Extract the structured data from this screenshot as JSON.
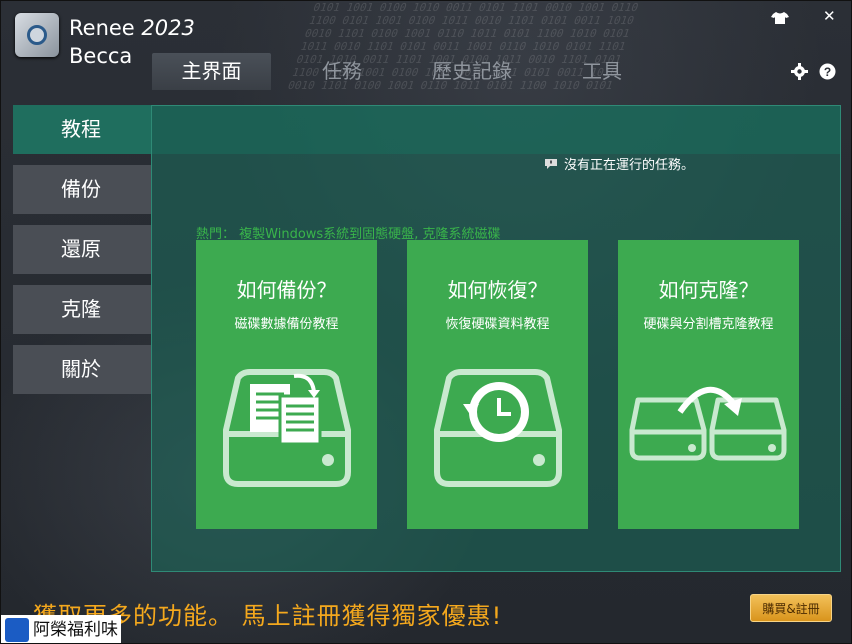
{
  "header": {
    "app_name": "Renee",
    "version": "2023",
    "product": "Becca",
    "tabs": [
      {
        "label": "主界面",
        "active": true
      },
      {
        "label": "任務",
        "active": false
      },
      {
        "label": "歷史記錄",
        "active": false
      },
      {
        "label": "工具",
        "active": false
      }
    ],
    "window_controls": {
      "skin": "shirt-icon",
      "close": "✕"
    }
  },
  "sidebar": {
    "items": [
      {
        "label": "教程",
        "active": true
      },
      {
        "label": "備份",
        "active": false
      },
      {
        "label": "還原",
        "active": false
      },
      {
        "label": "克隆",
        "active": false
      },
      {
        "label": "關於",
        "active": false
      }
    ]
  },
  "main": {
    "status": "沒有正在運行的任務。",
    "hot_prefix": "熱門：",
    "hot_link_1": "複製Windows系統到固態硬盤",
    "hot_sep": ",",
    "hot_link_2": "克隆系統磁碟",
    "cards": [
      {
        "title": "如何備份？",
        "subtitle": "磁碟數據備份教程",
        "icon": "backup-drive-icon"
      },
      {
        "title": "如何恢復？",
        "subtitle": "恢復硬碟資料教程",
        "icon": "restore-drive-icon"
      },
      {
        "title": "如何克隆？",
        "subtitle": "硬碟與分割槽克隆教程",
        "icon": "clone-drives-icon"
      }
    ]
  },
  "footer": {
    "promo": "獲取更多的功能。 馬上註冊獲得獨家優惠!",
    "buy_button": "購買&註冊",
    "watermark": "阿榮福利味"
  },
  "colors": {
    "accent_green": "#3daa50",
    "panel_teal": "#1f6e5e",
    "promo_orange": "#f4a81d"
  }
}
